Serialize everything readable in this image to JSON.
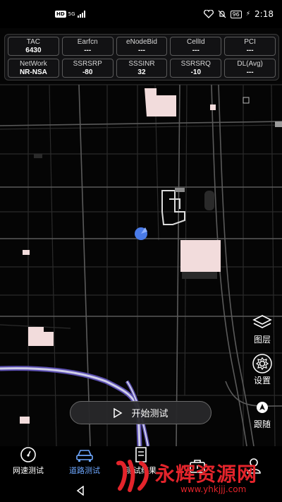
{
  "status_bar": {
    "hd_badge": "HD",
    "network_small": "5G",
    "battery": "96",
    "time": "2:18"
  },
  "info_grid": [
    {
      "label": "TAC",
      "value": "6430"
    },
    {
      "label": "Earfcn",
      "value": "---"
    },
    {
      "label": "eNodeBid",
      "value": "---"
    },
    {
      "label": "CellId",
      "value": "---"
    },
    {
      "label": "PCI",
      "value": "---"
    },
    {
      "label": "NetWork",
      "value": "NR-NSA"
    },
    {
      "label": "SSRSRP",
      "value": "-80"
    },
    {
      "label": "SSSINR",
      "value": "32"
    },
    {
      "label": "SSRSRQ",
      "value": "-10"
    },
    {
      "label": "DL(Avg)",
      "value": "---"
    }
  ],
  "tools": {
    "layers_label": "图层",
    "settings_label": "设置",
    "follow_label": "跟随"
  },
  "start_button": {
    "label": "开始测试"
  },
  "nav": [
    {
      "label": "网速测试",
      "icon": "speedometer-icon"
    },
    {
      "label": "道路测试",
      "icon": "car-icon"
    },
    {
      "label": "测试结果",
      "icon": "document-icon"
    },
    {
      "label": "",
      "icon": "toolbox-icon"
    },
    {
      "label": "",
      "icon": "user-icon"
    }
  ],
  "watermark": {
    "text": "永辉资源网",
    "url": "www.yhkjjj.com"
  },
  "colors": {
    "accent": "#6ea8ff",
    "location_dot": "#4a7be8",
    "building": "#f2dcdc",
    "watermark": "#e3242b"
  }
}
